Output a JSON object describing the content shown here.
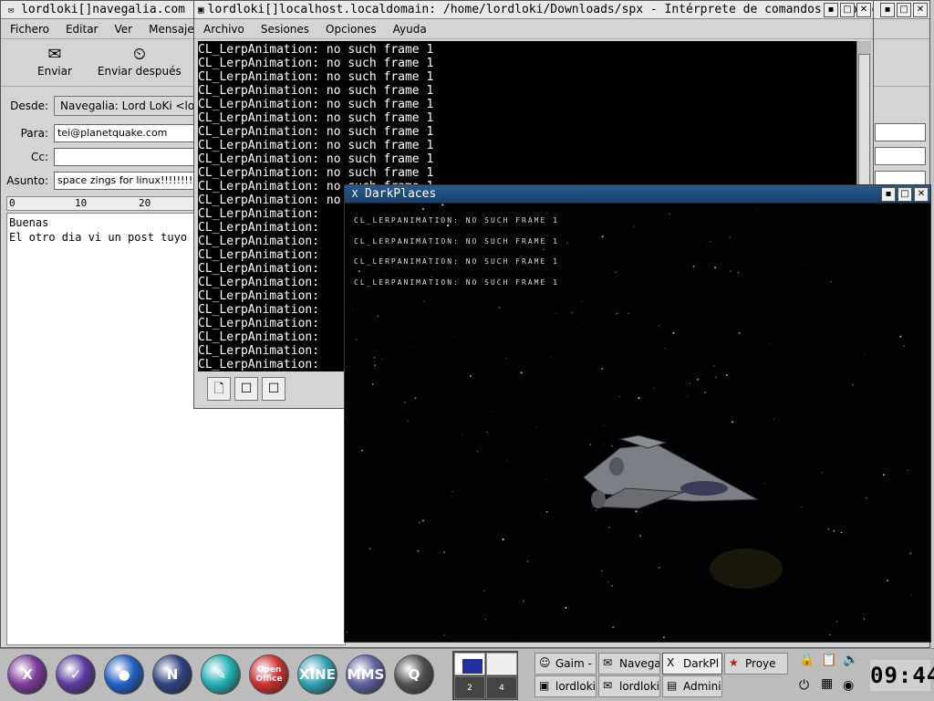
{
  "mail": {
    "title": "lordloki[]navegalia.com - C",
    "menu": [
      "Fichero",
      "Editar",
      "Ver",
      "Mensaje"
    ],
    "toolbar": {
      "send": "Enviar",
      "send_later": "Enviar después"
    },
    "from_label": "Desde:",
    "from_value": "Navegalia: Lord LoKi <lor",
    "to_label": "Para:",
    "to_value": "tei@planetquake.com",
    "cc_label": "Cc:",
    "cc_value": "",
    "subject_label": "Asunto:",
    "subject_value": "space zings for linux!!!!!!!!!",
    "ruler": [
      "0",
      "10",
      "20"
    ],
    "body": "Buenas\nEl otro dia vi un post tuyo e"
  },
  "konsole": {
    "title": "lordloki[]localhost.localdomain: /home/lordloki/Downloads/spx - Intérprete de comandos - Konsole",
    "menu": [
      "Archivo",
      "Sesiones",
      "Opciones",
      "Ayuda"
    ],
    "line": "CL_LerpAnimation: no such frame 1",
    "line_short": "CL_LerpAnimation:",
    "full_lines": 12,
    "short_lines": 12
  },
  "darkplaces": {
    "title": "DarkPlaces",
    "console_line": "CL_LERPANIMATION: NO SUCH FRAME 1"
  },
  "taskbar": {
    "launchers": [
      {
        "icon": "x-logo-icon",
        "label": "X",
        "color": "#7a3a9a"
      },
      {
        "icon": "checklist-icon",
        "label": "✓",
        "color": "#5a3aa0"
      },
      {
        "icon": "globe-icon",
        "label": "●",
        "color": "#2060c0"
      },
      {
        "icon": "netscape-icon",
        "label": "N",
        "color": "#304080"
      },
      {
        "icon": "pen-icon",
        "label": "✎",
        "color": "#20b0b0"
      },
      {
        "icon": "openoffice-icon",
        "label": "Open Office",
        "color": "#d03030"
      },
      {
        "icon": "xine-icon",
        "label": "XINE",
        "color": "#30a0b0"
      },
      {
        "icon": "mms-icon",
        "label": "MMS",
        "color": "#6060a0"
      },
      {
        "icon": "quake-icon",
        "label": "Q",
        "color": "#505050"
      }
    ],
    "pager": [
      "2",
      "4"
    ],
    "tasks": [
      {
        "label": "Gaim -",
        "icon": "☺"
      },
      {
        "label": "Navega",
        "icon": "✉"
      },
      {
        "label": "DarkPl",
        "icon": "X"
      },
      {
        "label": "Proye",
        "icon": "★"
      },
      {
        "label": "lordloki",
        "icon": "▣"
      },
      {
        "label": "lordloki",
        "icon": "✉"
      },
      {
        "label": "Adminis",
        "icon": "▤"
      }
    ],
    "clock": "09:44"
  }
}
